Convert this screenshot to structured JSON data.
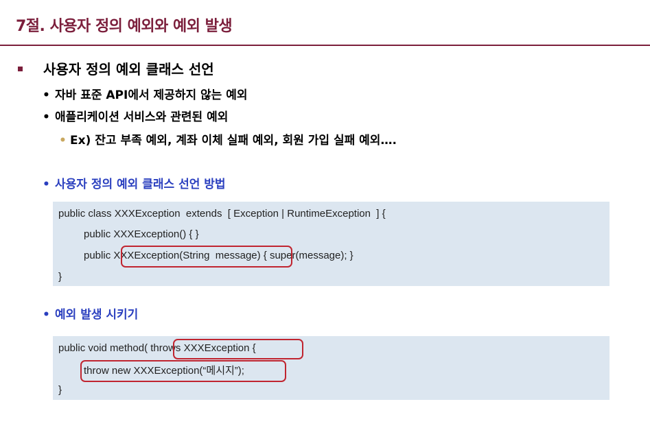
{
  "title": "7절. 사용자 정의 예외와 예외 발생",
  "section": {
    "heading": "사용자 정의 예외 클래스 선언",
    "bullets": [
      "자바 표준 API에서 제공하지 않는 예외",
      "애플리케이션 서비스와 관련된 예외"
    ],
    "sub_bullet": "Ex) 잔고 부족 예외, 계좌 이체 실패 예외, 회원 가입 실패 예외….",
    "bullet_char": "•",
    "sub_bullet_char": "•"
  },
  "declare": {
    "heading": "사용자 정의 예외 클래스 선언 방법",
    "line1": "public class XXXException  extends  [ Exception | RuntimeException  ] {",
    "line2": "public XXXException() { }",
    "line3_pre": "public ",
    "line3_hl": "XXXException(String  message)",
    "line3_post": " { super(message); }",
    "line4": "}"
  },
  "throwing": {
    "heading": "예외 발생 시키기",
    "line1_pre": "public void method(",
    "line1_hl": " throws XXXException ",
    "line1_post": "{",
    "line2_hl": "throw new XXXException(“메시지”);",
    "line3": "}"
  },
  "colors": {
    "title": "#7b1e3b",
    "heading_blue": "#2a3fbf",
    "code_bg": "#dce6f0",
    "highlight": "#c0242f"
  }
}
